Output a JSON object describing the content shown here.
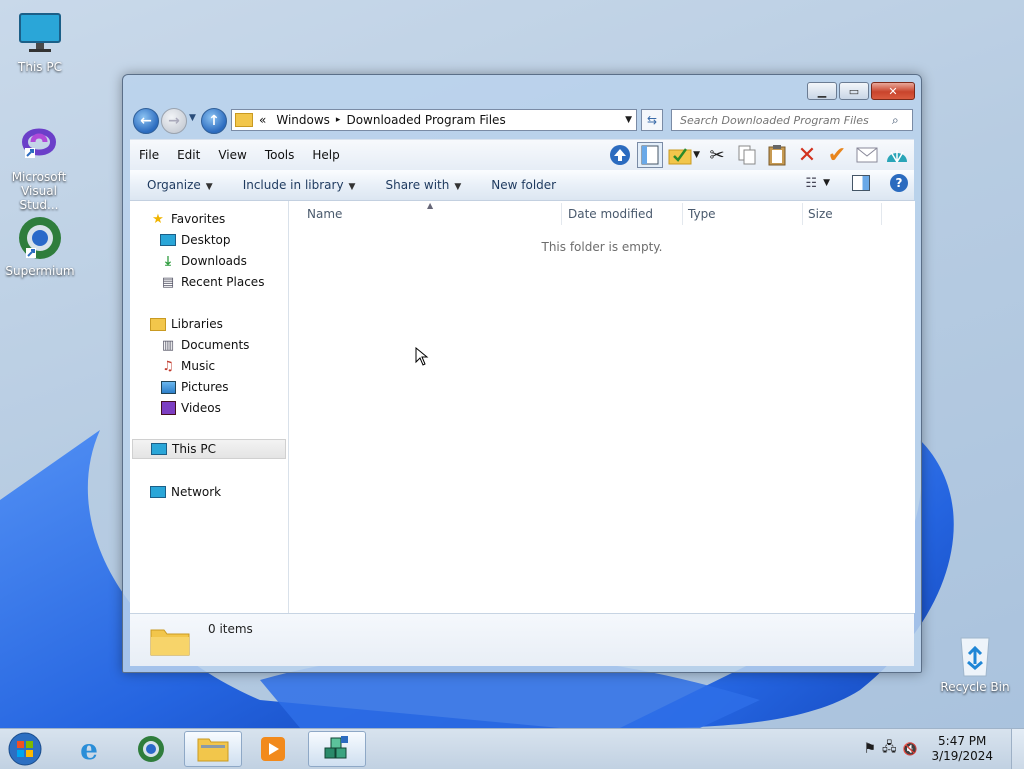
{
  "desktop": {
    "icons": [
      {
        "label": "This PC"
      },
      {
        "label": "Microsoft Visual Stud..."
      },
      {
        "label": "Supermium"
      },
      {
        "label": "Recycle Bin"
      }
    ]
  },
  "window": {
    "address": {
      "chevron": "«",
      "segments": [
        "Windows",
        "Downloaded Program Files"
      ],
      "separator": "▸"
    },
    "search_placeholder": "Search Downloaded Program Files",
    "menu": [
      "File",
      "Edit",
      "View",
      "Tools",
      "Help"
    ],
    "commands": {
      "organize": "Organize",
      "include_in_library": "Include in library",
      "share_with": "Share with",
      "new_folder": "New folder"
    },
    "nav": {
      "favorites": "Favorites",
      "desktop": "Desktop",
      "downloads": "Downloads",
      "recent_places": "Recent Places",
      "libraries": "Libraries",
      "documents": "Documents",
      "music": "Music",
      "pictures": "Pictures",
      "videos": "Videos",
      "this_pc": "This PC",
      "network": "Network"
    },
    "columns": [
      "Name",
      "Date modified",
      "Type",
      "Size"
    ],
    "empty_message": "This folder is empty.",
    "details": {
      "items": "0 items"
    }
  },
  "taskbar": {
    "clock_time": "5:47 PM",
    "clock_date": "3/19/2024"
  },
  "colors": {
    "accent": "#2b6bbf",
    "close_red": "#c9442c",
    "bloom_blue": "#1d5fe0"
  }
}
